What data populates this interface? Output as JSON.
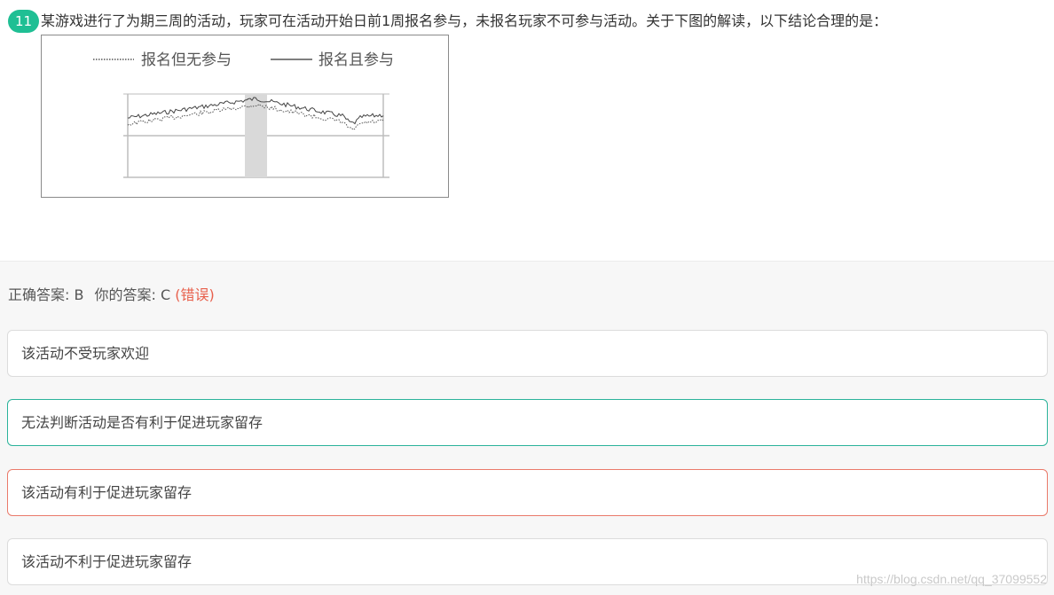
{
  "question": {
    "number": "11",
    "text": "某游戏进行了为期三周的活动，玩家可在活动开始日前1周报名参与，未报名玩家不可参与活动。关于下图的解读，以下结论合理的是："
  },
  "figure": {
    "legend": [
      {
        "label": "报名但无参与",
        "style": "dotted"
      },
      {
        "label": "报名且参与",
        "style": "solid"
      }
    ]
  },
  "answer": {
    "correct_label": "正确答案: B",
    "yours_label": "你的答案: C",
    "verdict": "(错误)"
  },
  "options": [
    {
      "text": "该活动不受玩家欢迎",
      "state": "none"
    },
    {
      "text": "无法判断活动是否有利于促进玩家留存",
      "state": "correct"
    },
    {
      "text": "该活动有利于促进玩家留存",
      "state": "chosen-wrong"
    },
    {
      "text": "该活动不利于促进玩家留存",
      "state": "none"
    }
  ],
  "watermark": "https://blog.csdn.net/qq_37099552",
  "colors": {
    "badge": "#1fbf94",
    "correct_border": "#2bb39a",
    "wrong_border": "#ea7a6a",
    "wrong_text": "#e8604c"
  }
}
